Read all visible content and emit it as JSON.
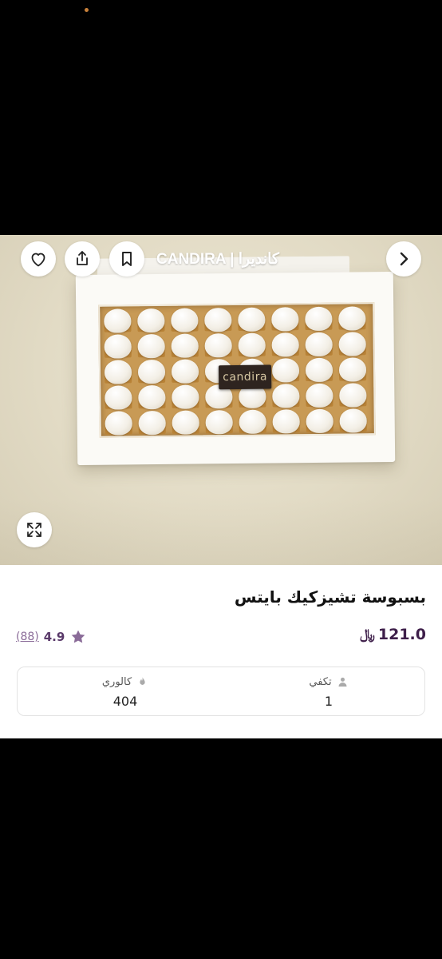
{
  "store": {
    "name": "CANDIRA | كانديرا"
  },
  "image": {
    "brand_plaque": "candira"
  },
  "product": {
    "title": "بسبوسة تشيزكيك بايتس",
    "price": "121.0",
    "currency": "﷼",
    "rating": "4.9",
    "rating_count": "(88)"
  },
  "info": {
    "serves_label": "تكفي",
    "serves_value": "1",
    "calories_label": "كالوري",
    "calories_value": "404"
  },
  "colors": {
    "accent": "#3e1f4a",
    "rating_star": "#8a6b98"
  }
}
